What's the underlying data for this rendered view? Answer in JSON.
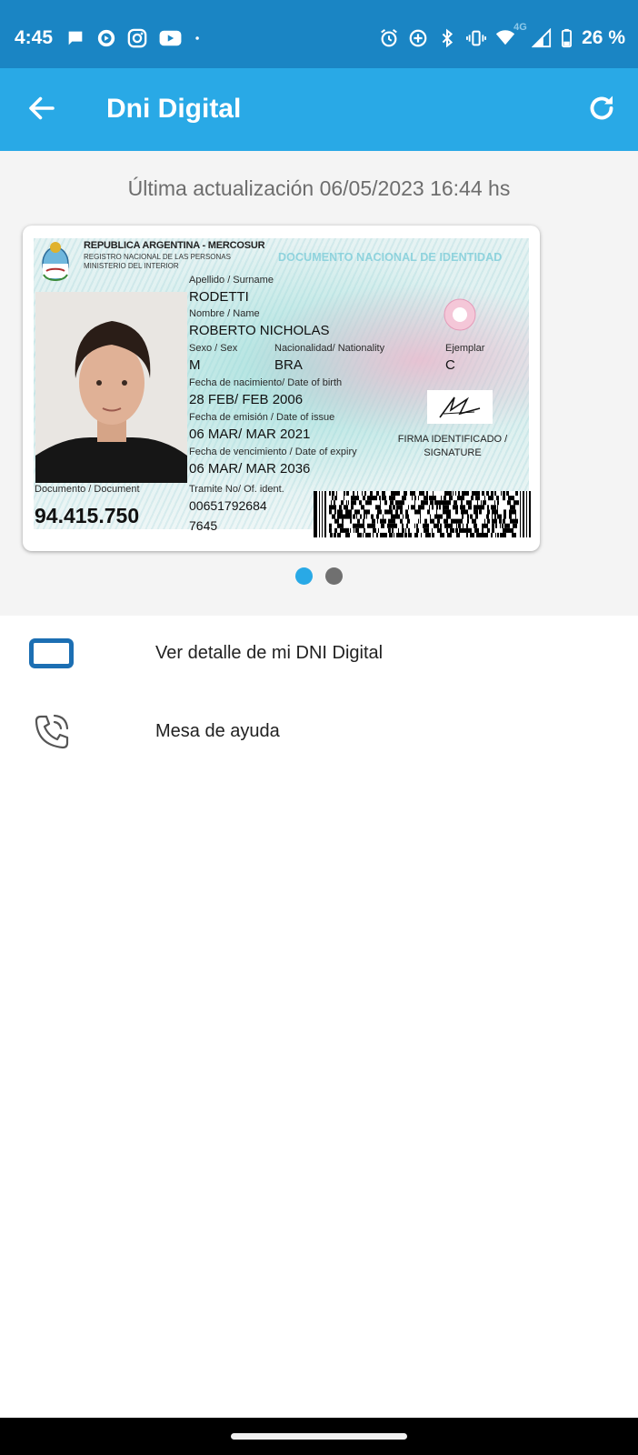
{
  "status_bar": {
    "time": "4:45",
    "battery_percent": "26 %",
    "network_label": "4G",
    "left_icons": [
      "chat-bubble-icon",
      "play-circle-icon",
      "instagram-icon",
      "youtube-icon",
      "dot-icon"
    ],
    "right_icons": [
      "alarm-icon",
      "location-icon",
      "bluetooth-icon",
      "vibrate-icon",
      "wifi-icon",
      "signal-icon",
      "battery-icon"
    ]
  },
  "app_bar": {
    "title": "Dni Digital",
    "back_icon": "arrow-left-icon",
    "refresh_icon": "refresh-icon"
  },
  "last_update": "Última actualización 06/05/2023 16:44 hs",
  "dni_card": {
    "country": "REPUBLICA ARGENTINA -  MERCOSUR",
    "registry": "REGISTRO NACIONAL DE LAS PERSONAS",
    "ministry": "MINISTERIO DEL INTERIOR",
    "document_title": "DOCUMENTO NACIONAL DE IDENTIDAD",
    "surname_label": "Apellido / Surname",
    "surname": "RODETTI",
    "name_label": "Nombre / Name",
    "name": "ROBERTO NICHOLAS",
    "sex_label": "Sexo / Sex",
    "sex": "M",
    "nationality_label": "Nacionalidad/ Nationality",
    "nationality": "BRA",
    "copy_label": "Ejemplar",
    "copy": "C",
    "dob_label": "Fecha de nacimiento/ Date of birth",
    "dob": "28 FEB/ FEB 2006",
    "issue_label": "Fecha de emisión / Date of issue",
    "issue_date": "06 MAR/ MAR 2021",
    "expiry_label": "Fecha de vencimiento / Date of expiry",
    "expiry_date": "06 MAR/ MAR 2036",
    "signature_caption_line1": "FIRMA IDENTIFICADO /",
    "signature_caption_line2": "SIGNATURE",
    "document_label": "Documento / Document",
    "document_number": "94.415.750",
    "tramite_label": "Tramite No/ Of. ident.",
    "tramite_number": "00651792684",
    "tramite_suffix": "7645"
  },
  "carousel": {
    "page_count": 2,
    "active_index": 0
  },
  "menu": [
    {
      "label": "Ver detalle de mi DNI Digital",
      "icon": "id-card-icon"
    },
    {
      "label": "Mesa de ayuda",
      "icon": "phone-call-icon"
    }
  ],
  "colors": {
    "status_bar": "#1a85c4",
    "app_bar": "#29a9e6",
    "accent": "#29a9e6",
    "id_icon": "#1c6fb3"
  }
}
